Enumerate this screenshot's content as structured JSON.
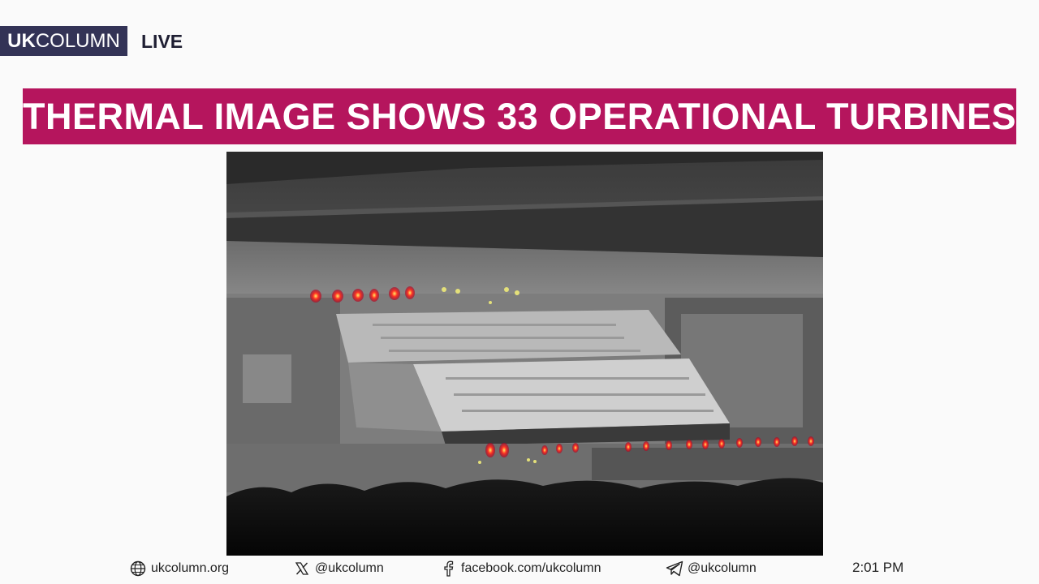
{
  "brand": {
    "name_bold": "UK",
    "name_regular": "COLUMN",
    "live_label": "LIVE",
    "box_color": "#333356"
  },
  "headline": {
    "text": "THERMAL IMAGE SHOWS 33 OPERATIONAL TURBINES",
    "background_color": "#b5155d"
  },
  "video": {
    "icon": "thermal-aerial-image"
  },
  "footer": {
    "website": {
      "icon": "globe-icon",
      "label": "ukcolumn.org"
    },
    "x": {
      "icon": "x-logo-icon",
      "label": "@ukcolumn"
    },
    "facebook": {
      "icon": "facebook-icon",
      "label": "facebook.com/ukcolumn"
    },
    "telegram": {
      "icon": "telegram-icon",
      "label": "@ukcolumn"
    },
    "clock": "2:01 PM"
  }
}
